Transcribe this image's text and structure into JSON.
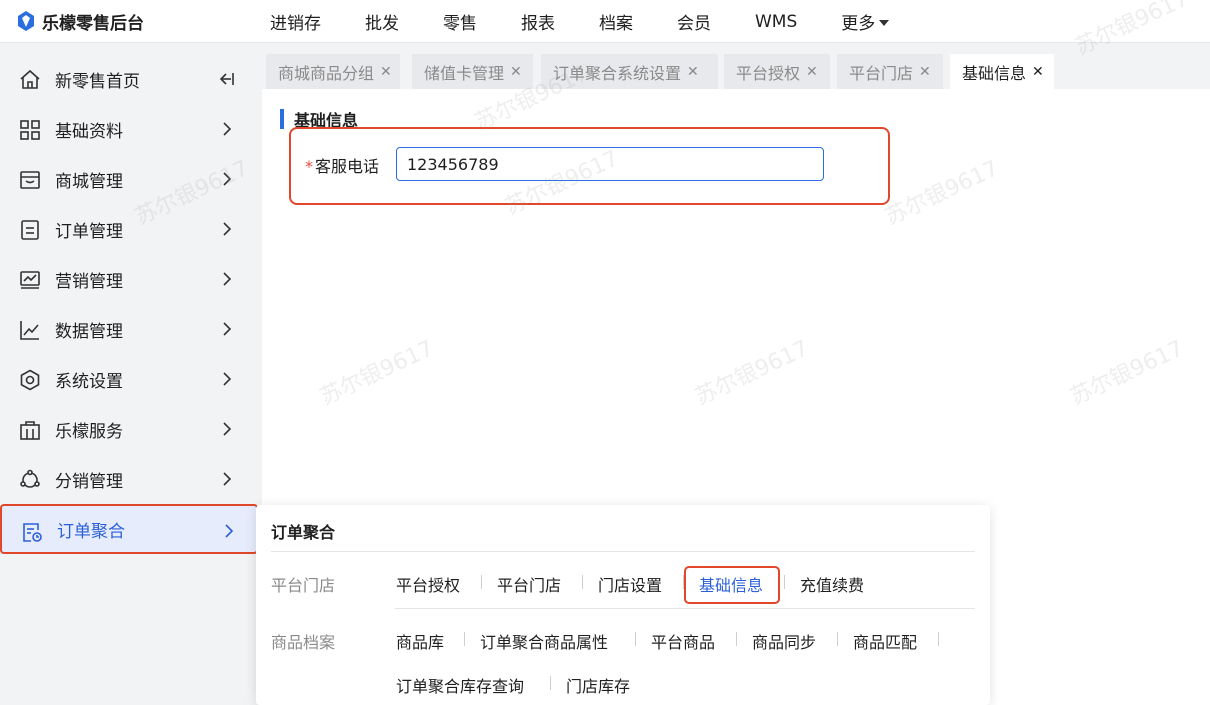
{
  "app": {
    "name": "乐檬零售后台"
  },
  "topnav": {
    "items": [
      "进销存",
      "批发",
      "零售",
      "报表",
      "档案",
      "会员",
      "WMS",
      "更多"
    ]
  },
  "sidebar": {
    "items": [
      {
        "label": "新零售首页",
        "icon": "home-icon"
      },
      {
        "label": "基础资料",
        "icon": "grid-icon"
      },
      {
        "label": "商城管理",
        "icon": "store-icon"
      },
      {
        "label": "订单管理",
        "icon": "order-icon"
      },
      {
        "label": "营销管理",
        "icon": "monitor-icon"
      },
      {
        "label": "数据管理",
        "icon": "chart-line-icon"
      },
      {
        "label": "系统设置",
        "icon": "gear-hex-icon"
      },
      {
        "label": "乐檬服务",
        "icon": "building-icon"
      },
      {
        "label": "分销管理",
        "icon": "network-icon"
      },
      {
        "label": "订单聚合",
        "icon": "order-aggregate-icon"
      }
    ]
  },
  "tabs": [
    {
      "label": "商城商品分组"
    },
    {
      "label": "储值卡管理"
    },
    {
      "label": "订单聚合系统设置"
    },
    {
      "label": "平台授权"
    },
    {
      "label": "平台门店"
    },
    {
      "label": "基础信息"
    }
  ],
  "content": {
    "section_title": "基础信息",
    "field": {
      "required_mark": "*",
      "label": "客服电话",
      "value": "123456789"
    }
  },
  "flyout": {
    "title": "订单聚合",
    "groups": [
      {
        "name": "平台门店",
        "links": [
          "平台授权",
          "平台门店",
          "门店设置",
          "基础信息",
          "充值续费"
        ]
      },
      {
        "name": "商品档案",
        "links": [
          "商品库",
          "订单聚合商品属性",
          "平台商品",
          "商品同步",
          "商品匹配",
          "订单聚合库存查询",
          "门店库存"
        ]
      }
    ]
  },
  "watermark": "苏尔银9617",
  "colors": {
    "accent": "#2b5fd9",
    "highlight_border": "#e0472b",
    "sidebar_bg": "#f2f3f5"
  }
}
